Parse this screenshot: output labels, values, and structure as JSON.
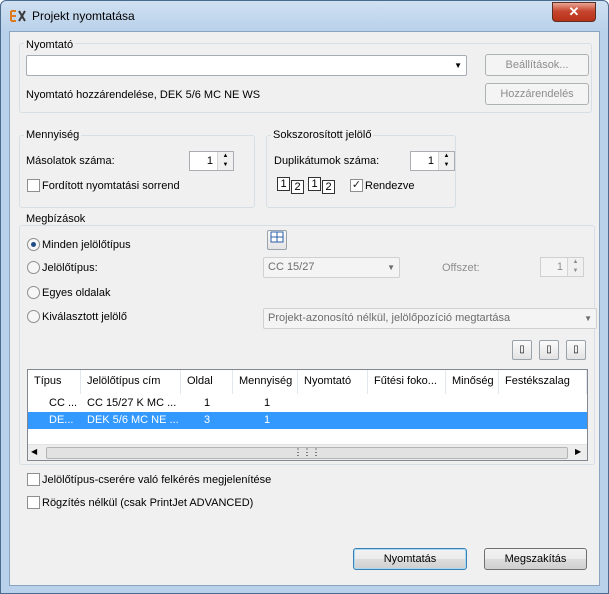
{
  "window": {
    "title": "Projekt nyomtatása",
    "close": "✕"
  },
  "printer": {
    "group_label": "Nyomtató",
    "selected": "",
    "settings_button": "Beállítások...",
    "assignment_text": "Nyomtató hozzárendelése, DEK 5/6 MC NE WS",
    "assign_button": "Hozzárendelés"
  },
  "quantity": {
    "group_label": "Mennyiség",
    "copies_label": "Másolatok száma:",
    "copies_value": "1",
    "reverse_label": "Fordított nyomtatási sorrend",
    "reverse_checked": false
  },
  "duplicate": {
    "group_label": "Sokszorosított jelölő",
    "count_label": "Duplikátumok száma:",
    "count_value": "1",
    "preview": [
      "1",
      "2",
      "1",
      "2"
    ],
    "sorted_label": "Rendezve",
    "sorted_checked": true
  },
  "jobs": {
    "group_label": "Megbízások",
    "radios": [
      {
        "label": "Minden jelölőtípus",
        "selected": true
      },
      {
        "label": "Jelölőtípus:",
        "selected": false
      },
      {
        "label": "Egyes oldalak",
        "selected": false
      },
      {
        "label": "Kiválasztott jelölő",
        "selected": false
      }
    ],
    "marker_type_value": "CC 15/27",
    "offset_label": "Offszet:",
    "offset_value": "1",
    "selected_marker_value": "Projekt-azonosító nélkül, jelölőpozíció megtartása"
  },
  "table": {
    "columns": [
      "Típus",
      "Jelölőtípus cím",
      "Oldal",
      "Mennyiség",
      "Nyomtató",
      "Fűtési foko...",
      "Minőség",
      "Festékszalag"
    ],
    "rows": [
      {
        "type": "CC ...",
        "title": "CC 15/27 K MC ...",
        "page": "1",
        "qty": "1",
        "selected": false
      },
      {
        "type": "DE...",
        "title": "DEK 5/6 MC NE ...",
        "page": "3",
        "qty": "1",
        "selected": true
      }
    ]
  },
  "options": {
    "confirm_label": "Jelölőtípus-cserére való felkérés megjelenítése",
    "confirm_checked": false,
    "no_fix_label": "Rögzítés nélkül (csak PrintJet ADVANCED)",
    "no_fix_checked": false
  },
  "footer": {
    "print_button": "Nyomtatás",
    "cancel_button": "Megszakítás"
  },
  "colors": {
    "selection": "#3399ff",
    "accent": "#3c7fb1"
  }
}
